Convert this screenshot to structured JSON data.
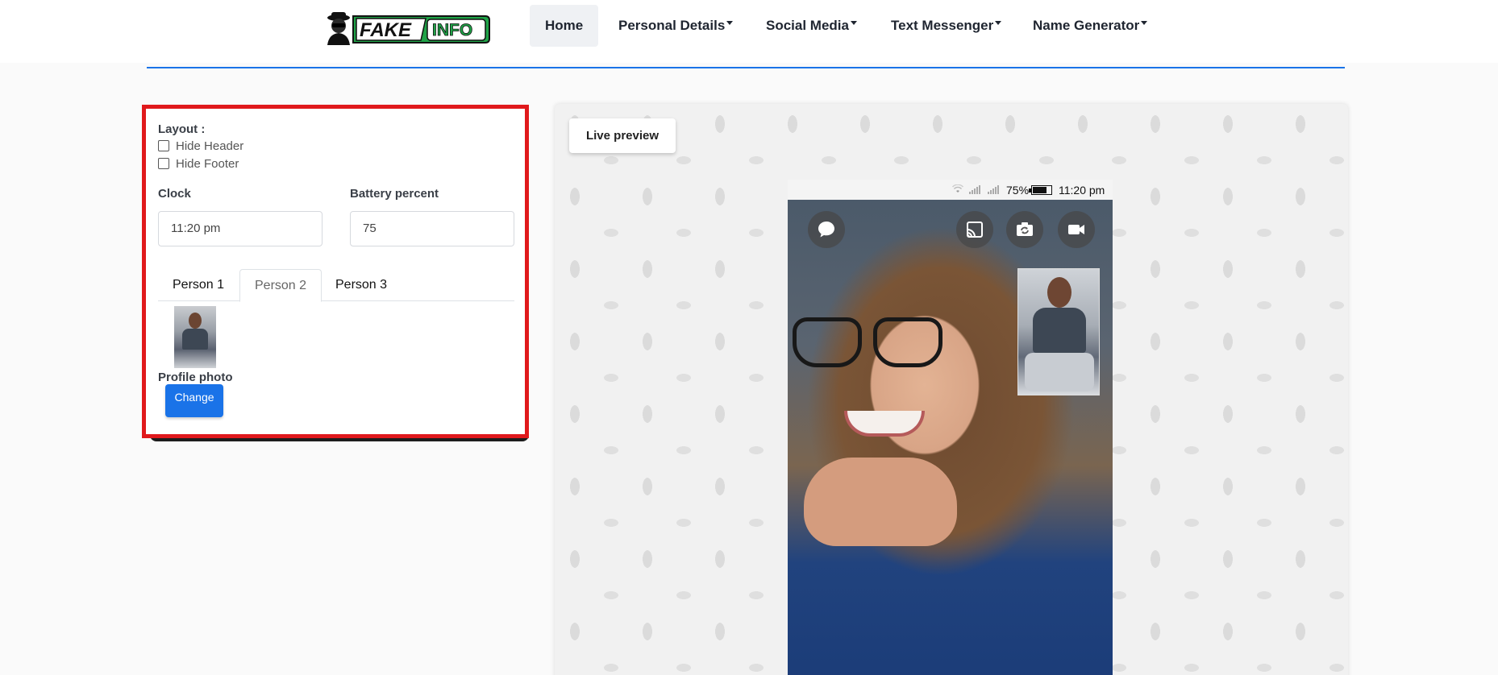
{
  "nav": {
    "logo_text": "FAKEINFO",
    "items": [
      {
        "label": "Home"
      },
      {
        "label": "Personal Details"
      },
      {
        "label": "Social Media"
      },
      {
        "label": "Text Messenger"
      },
      {
        "label": "Name Generator"
      }
    ]
  },
  "settings": {
    "layout_label": "Layout :",
    "hide_header_label": "Hide Header",
    "hide_footer_label": "Hide Footer",
    "clock_label": "Clock",
    "clock_value": "11:20 pm",
    "battery_label": "Battery percent",
    "battery_value": "75",
    "tabs": [
      {
        "label": "Person 1"
      },
      {
        "label": "Person 2"
      },
      {
        "label": "Person 3"
      }
    ],
    "active_tab": "Person 2",
    "profile_photo_label": "Profile photo",
    "change_label": "Change"
  },
  "preview": {
    "live_preview_label": "Live preview",
    "status": {
      "battery_text": "75%",
      "battery_level": 0.75,
      "time": "11:20 pm"
    },
    "call_icons": [
      "chat-bubble-icon",
      "cast-icon",
      "switch-camera-icon",
      "video-camera-icon"
    ]
  },
  "colors": {
    "accent": "#1a73e8",
    "highlight_border": "#e0191c",
    "logo_green": "#1fa347"
  }
}
